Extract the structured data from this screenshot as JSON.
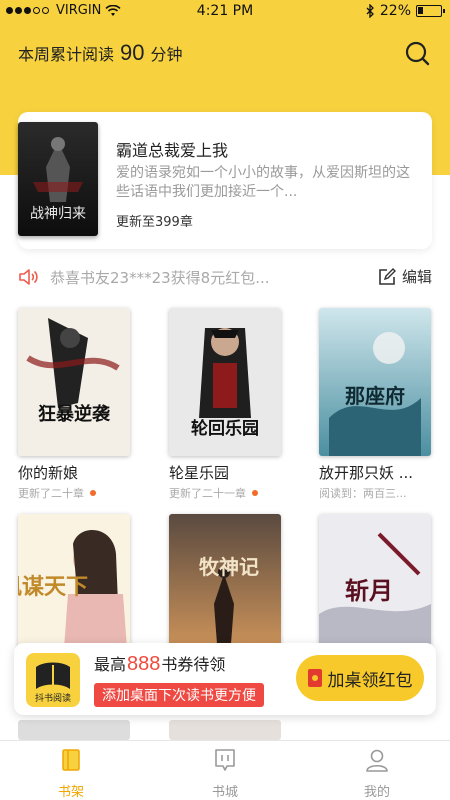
{
  "status_bar": {
    "carrier": "VIRGIN",
    "time": "4:21 PM",
    "battery": "22%",
    "battery_level": 0.22
  },
  "header": {
    "reading_label": "本周累计阅读",
    "reading_minutes": "90",
    "reading_unit": "分钟"
  },
  "featured": {
    "cover_title": "战神归来",
    "title": "霸道总裁爱上我",
    "description": "爱的语录宛如一个小小的故事，从爱因斯坦的这些话语中我们更加接近一个...",
    "update": "更新至399章"
  },
  "notice": {
    "text": "恭喜书友23***23获得8元红包...",
    "edit_label": "编辑"
  },
  "books": [
    {
      "name": "你的新娘",
      "status": "更新了二十章",
      "cover_text": "狂暴逆袭",
      "new": true
    },
    {
      "name": "轮星乐园",
      "status": "更新了二十一章",
      "cover_text": "轮回乐园",
      "new": true
    },
    {
      "name": "放开那只妖 ...",
      "status": "阅读到：两百三...",
      "cover_text": "那座府",
      "new": false
    },
    {
      "name": "",
      "status": "",
      "cover_text": "凤谋天下",
      "new": false
    },
    {
      "name": "",
      "status": "",
      "cover_text": "牧神记",
      "new": false
    },
    {
      "name": "",
      "status": "",
      "cover_text": "斩月",
      "new": false
    }
  ],
  "promo": {
    "logo_text": "抖书阅读",
    "line1_prefix": "最高",
    "line1_amount": "888",
    "line1_suffix": "书券待领",
    "line2": "添加桌面下次读书更方便",
    "cta": "加桌领红包"
  },
  "tabs": [
    {
      "label": "书架",
      "icon": "bookshelf-icon",
      "active": true
    },
    {
      "label": "书城",
      "icon": "bookstore-icon",
      "active": false
    },
    {
      "label": "我的",
      "icon": "profile-icon",
      "active": false
    }
  ],
  "colors": {
    "accent": "#f7d23e",
    "active_tab": "#f0a500",
    "promo_red": "#ee4a43"
  }
}
